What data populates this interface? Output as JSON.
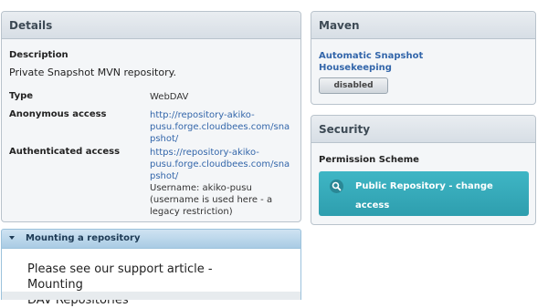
{
  "details": {
    "title": "Details",
    "description_label": "Description",
    "description_text": "Private Snapshot MVN repository.",
    "type_label": "Type",
    "type_value": "WebDAV",
    "anonymous_label": "Anonymous access",
    "anonymous_url_line1": "http://repository-akiko-",
    "anonymous_url_line2": "pusu.forge.cloudbees.com/sna",
    "anonymous_url_line3": "pshot/",
    "authenticated_label": "Authenticated access",
    "authenticated_url_line1": "https://repository-akiko-",
    "authenticated_url_line2": "pusu.forge.cloudbees.com/sna",
    "authenticated_url_line3": "pshot/",
    "username_line1": "Username: akiko-pusu",
    "username_line2": "(username is used here - a",
    "username_line3": "legacy restriction)"
  },
  "maven": {
    "title": "Maven",
    "housekeeping_line1": "Automatic Snapshot",
    "housekeeping_line2": "Housekeeping",
    "status": "disabled"
  },
  "security": {
    "title": "Security",
    "permission_label": "Permission Scheme",
    "permission_button_line1": "Public Repository - change",
    "permission_button_line2": "access"
  },
  "mounting": {
    "title": "Mounting a repository",
    "body_line1": "Please see our support article - Mounting",
    "body_line2": "DAV Repositories"
  }
}
